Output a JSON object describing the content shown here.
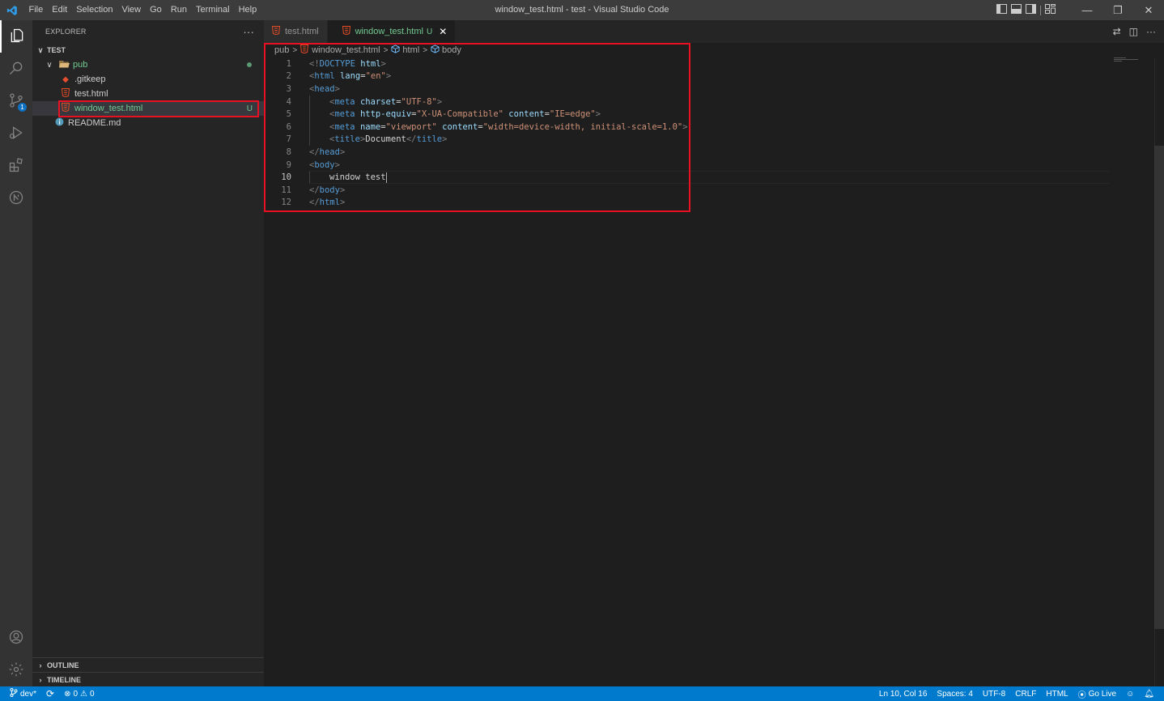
{
  "window": {
    "title": "window_test.html - test - Visual Studio Code",
    "min_glyph": "—",
    "restore_glyph": "❐",
    "close_glyph": "✕"
  },
  "menu": [
    "File",
    "Edit",
    "Selection",
    "View",
    "Go",
    "Run",
    "Terminal",
    "Help"
  ],
  "activity": {
    "items": [
      {
        "name": "explorer-icon",
        "active": true
      },
      {
        "name": "search-icon"
      },
      {
        "name": "source-control-icon",
        "badge": "1"
      },
      {
        "name": "run-debug-icon"
      },
      {
        "name": "extensions-icon"
      },
      {
        "name": "remote-icon"
      }
    ],
    "bottom": [
      {
        "name": "account-icon"
      },
      {
        "name": "settings-gear-icon"
      }
    ]
  },
  "sidebar": {
    "title": "EXPLORER",
    "more": "···",
    "root": "TEST",
    "folder": "pub",
    "files": [
      {
        "label": ".gitkeep",
        "icon": "git",
        "status": ""
      },
      {
        "label": "test.html",
        "icon": "html",
        "status": ""
      },
      {
        "label": "window_test.html",
        "icon": "html",
        "status": "U",
        "selected": true
      }
    ],
    "root_files": [
      {
        "label": "README.md",
        "icon": "info"
      }
    ],
    "outline": "OUTLINE",
    "timeline": "TIMELINE"
  },
  "tabs": [
    {
      "label": "test.html",
      "active": false
    },
    {
      "label": "window_test.html",
      "active": true,
      "modified": "U",
      "close": "✕"
    }
  ],
  "tab_actions": {
    "compare": "⇄",
    "split": "◫",
    "more": "···"
  },
  "breadcrumb": {
    "parts": [
      "pub",
      "window_test.html",
      "html",
      "body"
    ],
    "sep": ">"
  },
  "code": {
    "line_numbers": [
      "1",
      "2",
      "3",
      "4",
      "5",
      "6",
      "7",
      "8",
      "9",
      "10",
      "11",
      "12"
    ],
    "current_line": 10
  },
  "status": {
    "branch": "dev*",
    "errors": "0",
    "warnings": "0",
    "position": "Ln 10, Col 16",
    "spaces": "Spaces: 4",
    "encoding": "UTF-8",
    "eol": "CRLF",
    "language": "HTML",
    "golive": "Go Live"
  },
  "colors": {
    "accent": "#007acc",
    "highlight_box": "#e81123",
    "untracked": "#73c991",
    "html_icon": "#e44d26"
  }
}
